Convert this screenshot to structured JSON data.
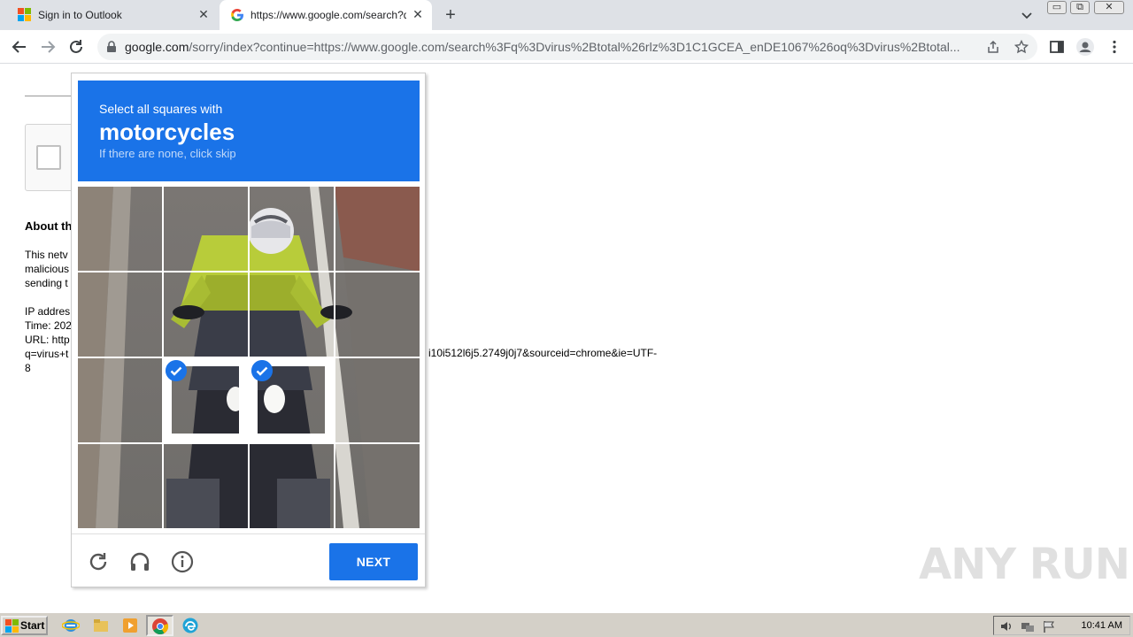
{
  "browser": {
    "tabs": [
      {
        "title": "Sign in to Outlook",
        "active": false
      },
      {
        "title": "https://www.google.com/search?q=",
        "active": true
      }
    ],
    "url_host": "google.com",
    "url_rest": "/sorry/index?continue=https://www.google.com/search%3Fq%3Dvirus%2Btotal%26rlz%3D1C1GCEA_enDE1067%26oq%3Dvirus%2Btotal..."
  },
  "page": {
    "about_title": "About th",
    "para_lines": [
      "This netv",
      "malicious",
      "sending t"
    ],
    "info_lines": [
      "IP addres",
      "Time: 202",
      "URL: http",
      "q=virus+t",
      "8"
    ],
    "url_tail": "i10i512l6j5.2749j0j7&sourceid=chrome&ie=UTF-"
  },
  "captcha": {
    "instruction_line1": "Select all squares with",
    "instruction_target": "motorcycles",
    "instruction_line3": "If there are none, click skip",
    "selected_tiles": [
      9,
      10
    ],
    "next_label": "NEXT",
    "icons": [
      "reload-icon",
      "audio-icon",
      "info-icon"
    ]
  },
  "watermark": "ANY RUN",
  "taskbar": {
    "start_label": "Start",
    "clock": "10:41 AM"
  },
  "colors": {
    "accent": "#1a73e8",
    "tabbar": "#dee1e6",
    "taskbar": "#d4d0c8"
  }
}
